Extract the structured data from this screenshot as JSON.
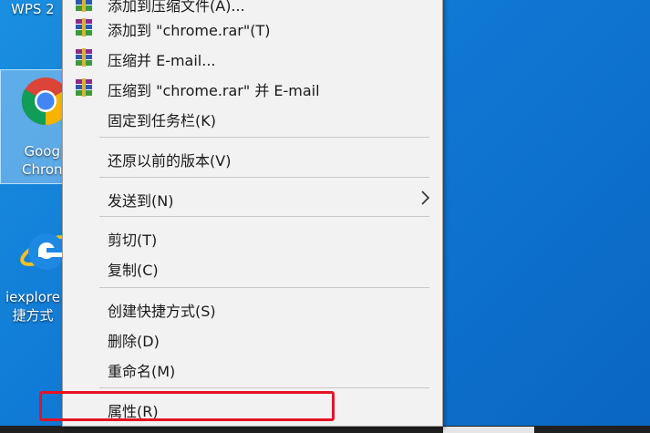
{
  "desktop": {
    "wps_label": "WPS 2",
    "chrome_label_line1": "Goog",
    "chrome_label_line2": "Chron",
    "ie_label_line1": "iexplore",
    "ie_label_line2": "捷方式"
  },
  "menu": {
    "items": [
      {
        "label": "添加到压缩文件(A)...",
        "icon": "winrar-icon"
      },
      {
        "label": "添加到 \"chrome.rar\"(T)",
        "icon": "winrar-icon"
      },
      {
        "label": "压缩并 E-mail...",
        "icon": "winrar-icon"
      },
      {
        "label": "压缩到 \"chrome.rar\" 并 E-mail",
        "icon": "winrar-icon"
      },
      {
        "label": "固定到任务栏(K)"
      },
      {
        "label": "还原以前的版本(V)"
      },
      {
        "label": "发送到(N)",
        "submenu": true
      },
      {
        "label": "剪切(T)"
      },
      {
        "label": "复制(C)"
      },
      {
        "label": "创建快捷方式(S)"
      },
      {
        "label": "删除(D)"
      },
      {
        "label": "重命名(M)"
      },
      {
        "label": "属性(R)",
        "highlighted": true
      }
    ]
  },
  "colors": {
    "highlight_border": "#e81123",
    "desktop_blue": "#0f78d4"
  }
}
